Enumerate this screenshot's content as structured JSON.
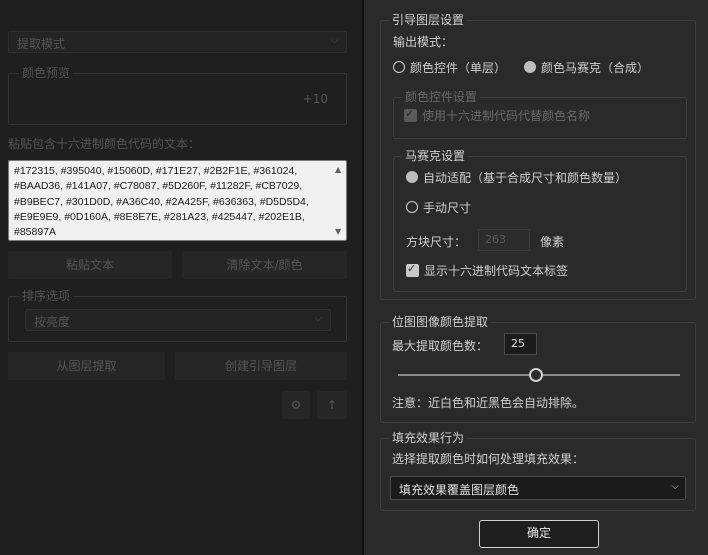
{
  "left": {
    "extract_mode": "提取模式",
    "color_preview_legend": "颜色预览",
    "preview_count": "+10",
    "paste_label": "粘贴包含十六进制颜色代码的文本：",
    "hex_text": "#172315, #395040, #15060D, #171E27, #2B2F1E, #361024,\n#BAAD36, #141A07, #C78087, #5D260F, #11282F, #CB7029,\n#B9BEC7, #301D0D, #A36C40, #2A425F, #636363, #D5D5D4,\n#E9E9E9, #0D160A, #8E8E7E, #281A23, #425447, #202E1B,\n#85897A",
    "paste_button": "粘贴文本",
    "clear_button": "清除文本/颜色",
    "sort_legend": "排序选项",
    "sort_value": "按亮度",
    "extract_layer_button": "从图层提取",
    "create_guide_button": "创建引导图层",
    "settings_icon": "gear-icon",
    "up_icon": "arrow-up-icon"
  },
  "guide": {
    "legend": "引导图层设置",
    "output_mode_label": "输出模式：",
    "option_controls": "颜色控件（单层）",
    "option_mosaic": "颜色马赛克（合成）",
    "selected": "mosaic",
    "controls_legend": "颜色控件设置",
    "use_hex_names": "使用十六进制代码代替颜色名称",
    "mosaic_legend": "马赛克设置",
    "auto_fit": "自动适配（基于合成尺寸和颜色数量）",
    "manual_size": "手动尺寸",
    "block_size_label": "方块尺寸：",
    "block_size_value": "263",
    "pixels_unit": "像素",
    "show_hex_labels": "显示十六进制代码文本标签"
  },
  "bitmap": {
    "legend": "位图图像颜色提取",
    "max_colors_label": "最大提取颜色数：",
    "max_colors_value": "25",
    "slider_fraction": 0.49,
    "note": "注意：近白色和近黑色会自动排除。"
  },
  "fill": {
    "legend": "填充效果行为",
    "description": "选择提取颜色时如何处理填充效果：",
    "selected_option": "填充效果覆盖图层颜色"
  },
  "ok_button": "确定",
  "colors": {
    "panel": "#2a2a2a",
    "background": "#1e1e1e",
    "text": "#d0d0d0"
  }
}
